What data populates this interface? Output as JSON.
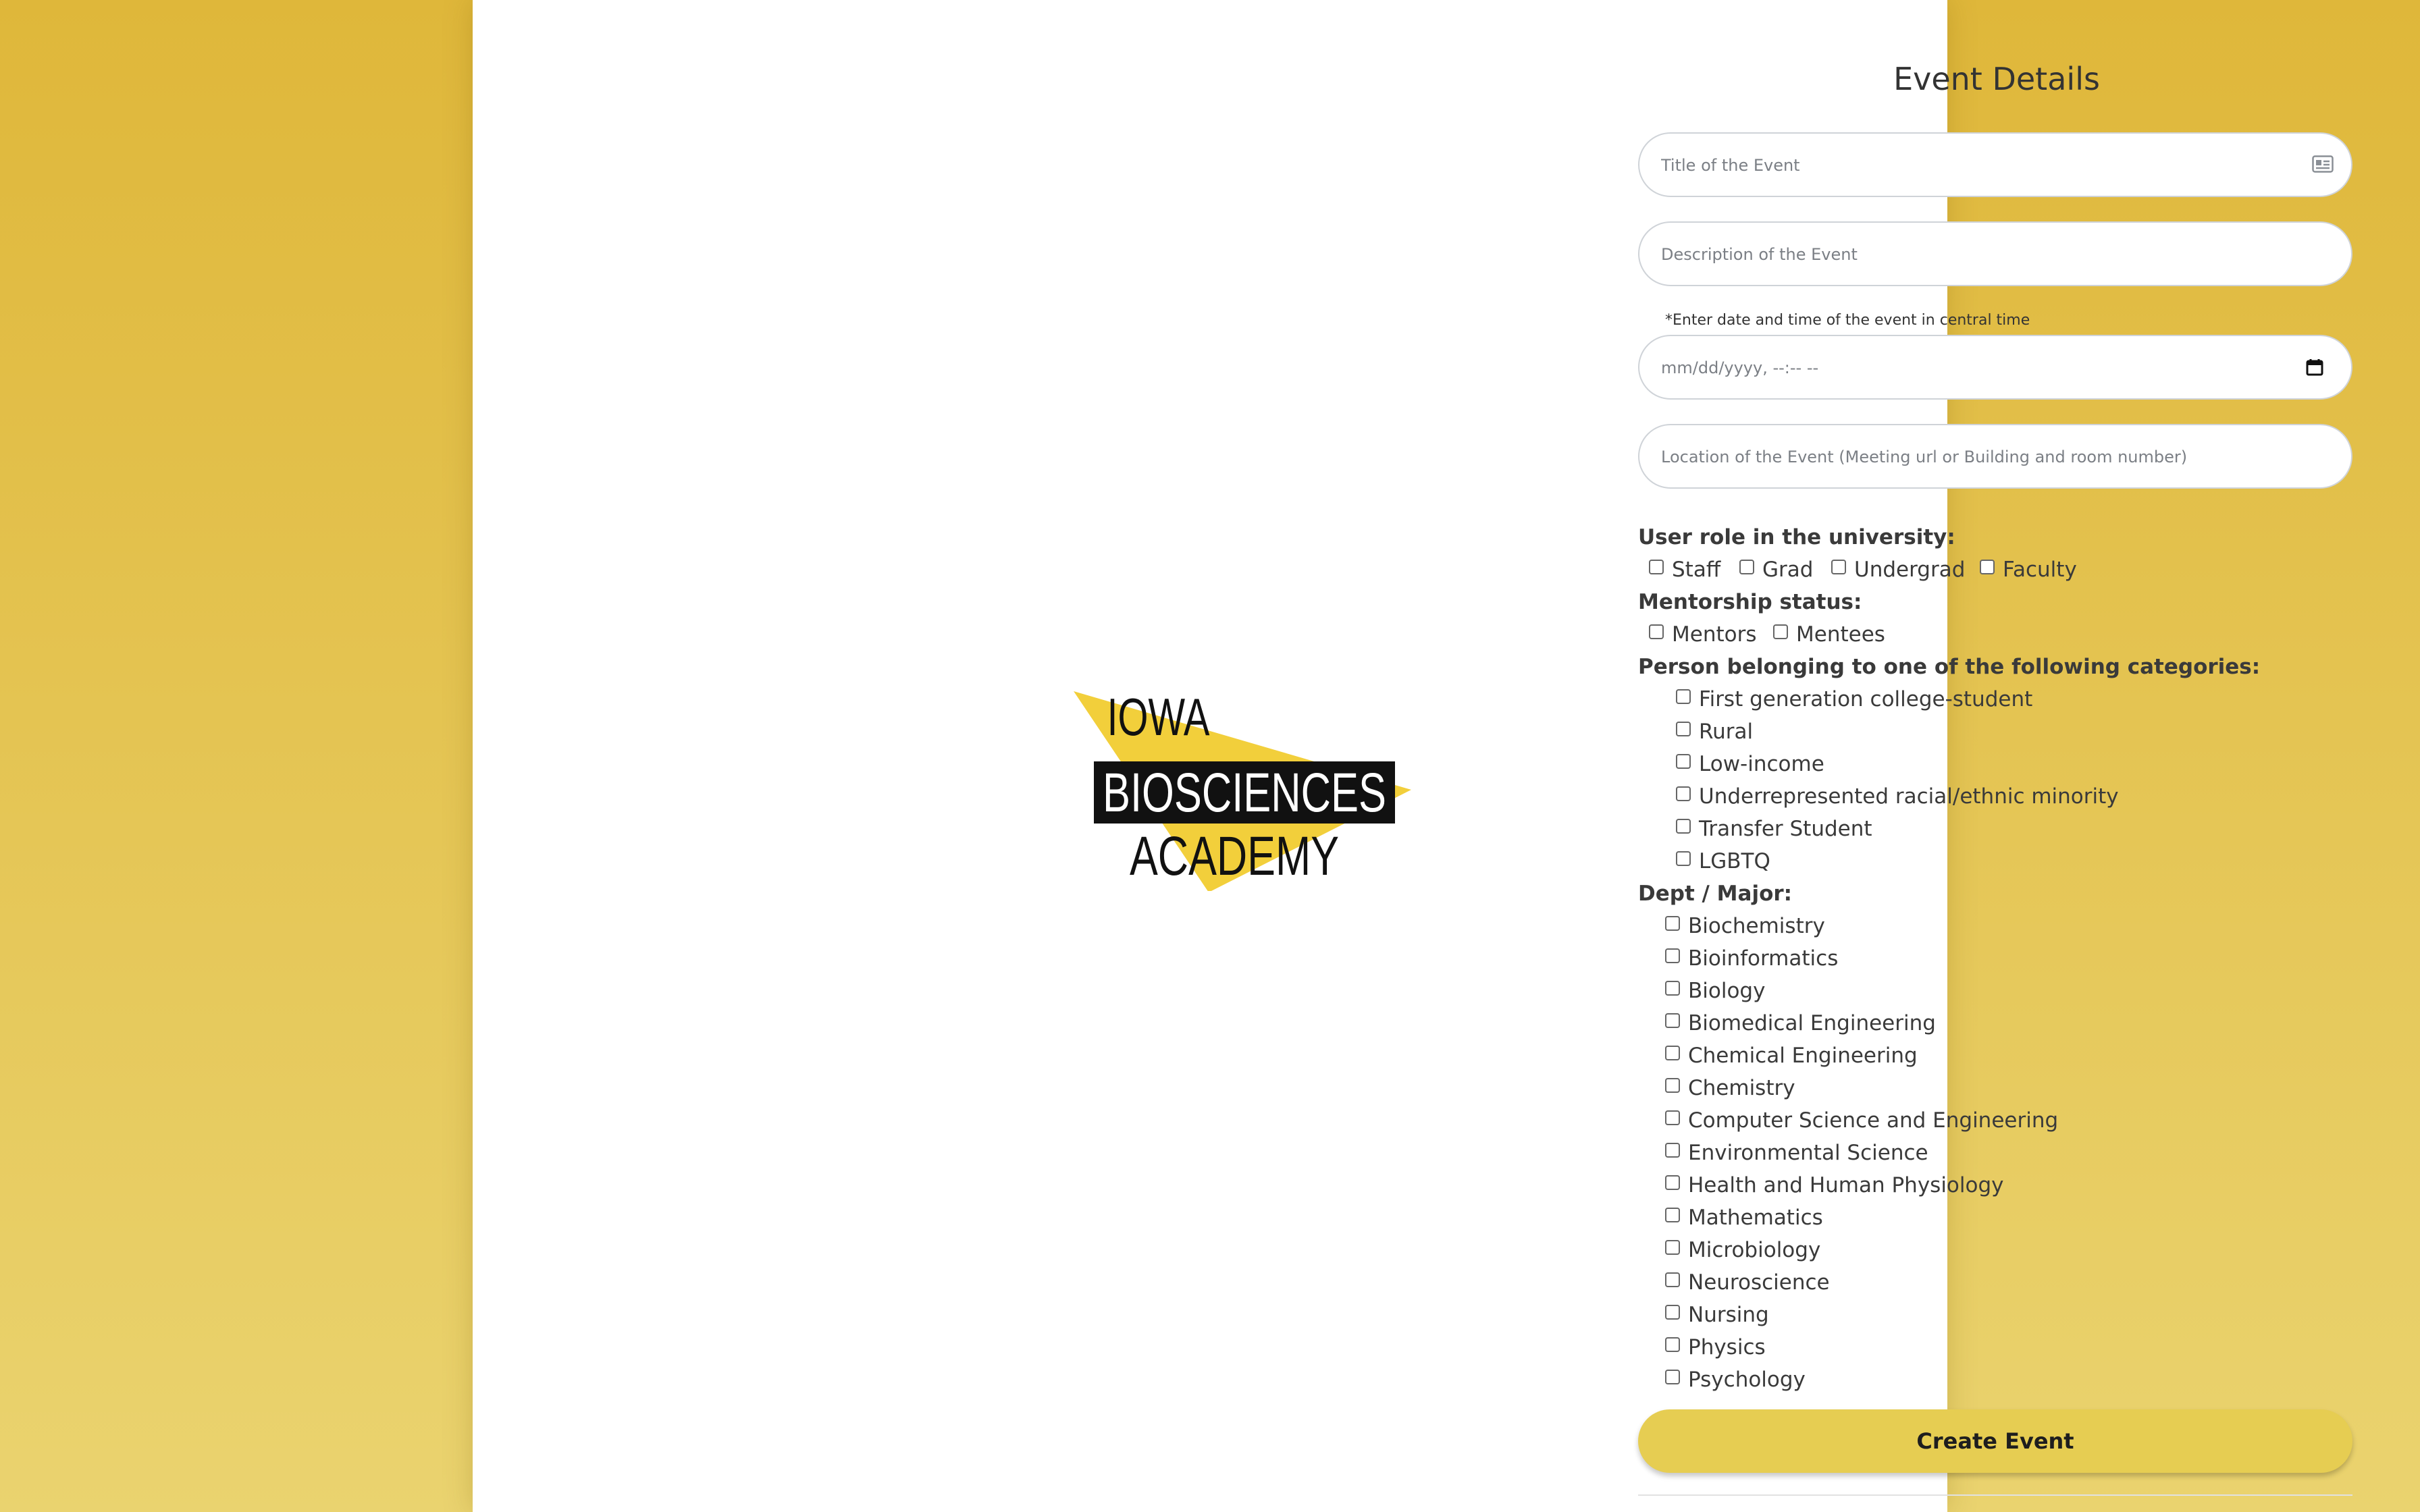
{
  "logo": {
    "line1": "IOWA",
    "line2": "BIOSCIENCES",
    "line3": "ACADEMY",
    "accent_color": "#f2cf3b"
  },
  "form": {
    "title": "Event Details",
    "title_placeholder": "Title of the Event",
    "description_placeholder": "Description of the Event",
    "date_note": "*Enter date and time of the event in central time",
    "datetime_placeholder": "mm/dd/yyyy, --:-- --",
    "location_placeholder": "Location of the Event (Meeting url or Building and room number)",
    "user_role_label": "User role in the university:",
    "user_roles": [
      "Staff",
      "Grad",
      "Undergrad",
      "Faculty"
    ],
    "mentorship_label": "Mentorship status:",
    "mentorship_options": [
      "Mentors",
      "Mentees"
    ],
    "categories_label": "Person belonging to one of the following categories:",
    "categories": [
      "First generation college-student",
      "Rural",
      "Low-income",
      "Underrepresented racial/ethnic minority",
      "Transfer Student",
      "LGBTQ"
    ],
    "dept_label": "Dept / Major:",
    "departments": [
      "Biochemistry",
      "Bioinformatics",
      "Biology",
      "Biomedical Engineering",
      "Chemical Engineering",
      "Chemistry",
      "Computer Science and Engineering",
      "Environmental Science",
      "Health and Human Physiology",
      "Mathematics",
      "Microbiology",
      "Neuroscience",
      "Nursing",
      "Physics",
      "Psychology"
    ],
    "submit_label": "Create Event"
  },
  "colors": {
    "background": "#e2c04a",
    "button": "#e6cd52",
    "card": "#ffffff"
  }
}
